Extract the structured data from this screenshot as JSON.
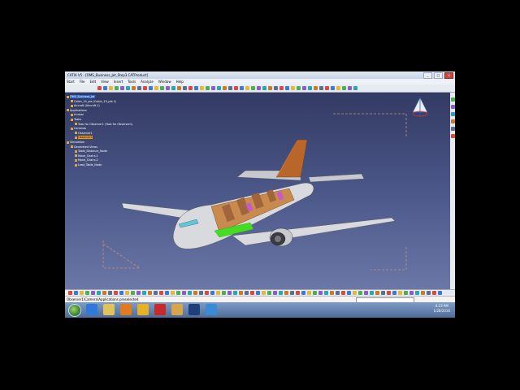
{
  "window": {
    "title": "CATIA V5 - [OMS_Business_Jet_Step3.CATProduct]",
    "controls": [
      "_",
      "□",
      "×"
    ]
  },
  "menu": [
    "Start",
    "File",
    "Edit",
    "View",
    "Insert",
    "Tools",
    "Analyze",
    "Window",
    "Help"
  ],
  "tree": {
    "items": [
      {
        "label": "OMS_Business_Jet",
        "level": 0,
        "state": "selected"
      },
      {
        "label": "Cabin_19_pts (Cabin_19_pts.1)",
        "level": 1,
        "state": "normal"
      },
      {
        "label": "Aircraft (Aircraft.1)",
        "level": 1,
        "state": "normal"
      },
      {
        "label": "Applications",
        "level": 0,
        "state": "normal"
      },
      {
        "label": "Human",
        "level": 1,
        "state": "normal"
      },
      {
        "label": "Tasks",
        "level": 1,
        "state": "normal"
      },
      {
        "label": "Task for Observer1 (Task for Observer1)",
        "level": 2,
        "state": "normal"
      },
      {
        "label": "Cameras",
        "level": 1,
        "state": "normal"
      },
      {
        "label": "Observer1",
        "level": 2,
        "state": "normal"
      },
      {
        "label": "Observer2",
        "level": 2,
        "state": "orange"
      },
      {
        "label": "Simulation",
        "level": 0,
        "state": "normal"
      },
      {
        "label": "Generated Views",
        "level": 1,
        "state": "normal"
      },
      {
        "label": "Table_Distance_Node",
        "level": 2,
        "state": "normal"
      },
      {
        "label": "Move_Chairs.1",
        "level": 2,
        "state": "normal"
      },
      {
        "label": "Move_Chairs.2",
        "level": 2,
        "state": "normal"
      },
      {
        "label": "Lead_Table_Node",
        "level": 2,
        "state": "normal"
      }
    ]
  },
  "status": {
    "message": "Observer1\\Camera\\Applications preselected"
  },
  "clock": {
    "time": "4:23 PM",
    "date": "1/28/2016"
  },
  "taskbar": {
    "apps": [
      "ie-icon",
      "explorer-icon",
      "media-player-icon",
      "chrome-icon",
      "acrobat-icon",
      "folder-icon",
      "catia-icon",
      "app-icon"
    ]
  },
  "colors": {
    "viewport_top": "#333a63",
    "viewport_bottom": "#6b78a6",
    "selection": "#2864d0",
    "highlight": "#f39a1d",
    "fuselage": "#d9dade",
    "tail": "#b8662a",
    "cabin_section": "#c98a4e",
    "measure_green": "#44dd22"
  }
}
